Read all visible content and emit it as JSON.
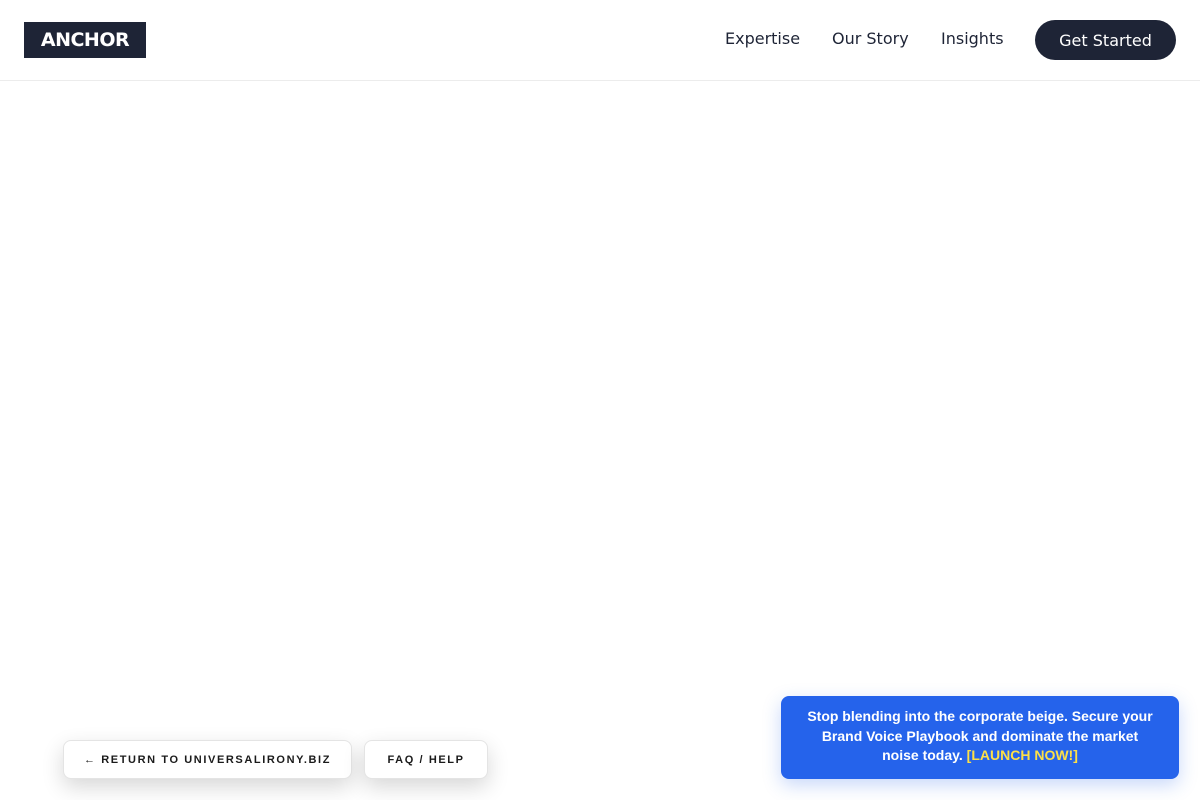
{
  "header": {
    "logo": "ANCHOR",
    "nav": {
      "expertise": "Expertise",
      "our_story": "Our Story",
      "insights": "Insights"
    },
    "cta_label": "Get Started"
  },
  "footer_links": {
    "return_label": "← RETURN TO UNIVERSALIRONY.BIZ",
    "faq_label": "FAQ / HELP"
  },
  "promo_banner": {
    "message": "Stop blending into the corporate beige. Secure your Brand Voice Playbook and dominate the market noise today.",
    "link_label": "[LAUNCH NOW!]"
  },
  "colors": {
    "brand_dark": "#1e2436",
    "promo_blue": "#2563eb",
    "promo_link_yellow": "#fde047",
    "background": "#ffffff"
  }
}
